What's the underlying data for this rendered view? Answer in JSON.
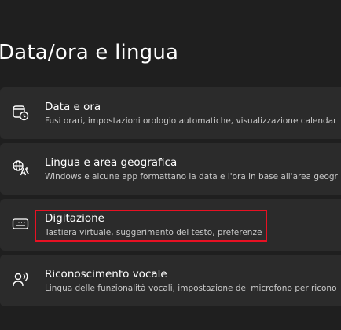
{
  "page": {
    "title": "Data/ora e lingua"
  },
  "settings": [
    {
      "title": "Data e ora",
      "subtitle": "Fusi orari, impostazioni orologio automatiche, visualizzazione calendar",
      "icon": "date-time-icon"
    },
    {
      "title": "Lingua e area geografica",
      "subtitle": "Windows e alcune app formattano la data e l'ora in base all'area geogr",
      "icon": "language-region-icon"
    },
    {
      "title": "Digitazione",
      "subtitle": "Tastiera virtuale, suggerimento del testo, preferenze",
      "icon": "keyboard-icon"
    },
    {
      "title": "Riconoscimento vocale",
      "subtitle": "Lingua delle funzionalità vocali, impostazione del microfono per ricono",
      "icon": "speech-icon"
    }
  ],
  "colors": {
    "background": "#1f1f1f",
    "card": "#2b2b2b",
    "highlight": "#e81123",
    "text": "#ffffff",
    "subtext": "#c9c9c9"
  }
}
